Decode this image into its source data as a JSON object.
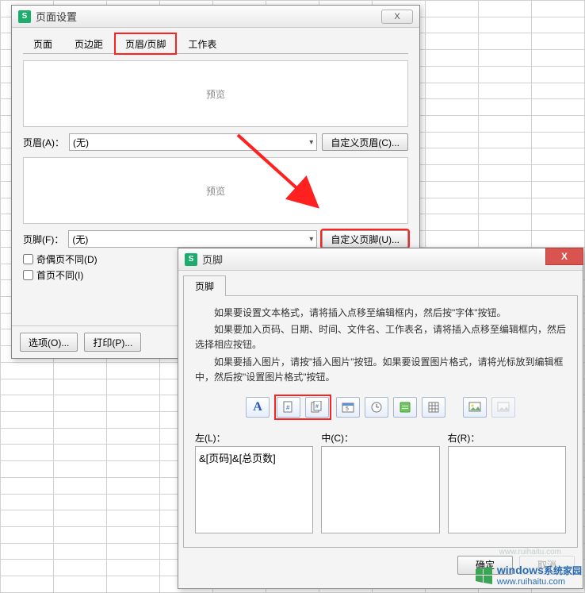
{
  "page_setup": {
    "title": "页面设置",
    "close_glyph": "X",
    "tabs": {
      "page": "页面",
      "margins": "页边距",
      "header_footer": "页眉/页脚",
      "sheet": "工作表"
    },
    "preview_label": "预览",
    "header_label": "页眉(A)：",
    "header_value": "(无)",
    "custom_header_btn": "自定义页眉(C)...",
    "footer_label": "页脚(F)：",
    "footer_value": "(无)",
    "custom_footer_btn": "自定义页脚(U)...",
    "odd_even_diff": "奇偶页不同(D)",
    "first_page_diff": "首页不同(I)",
    "options_btn": "选项(O)...",
    "print_btn": "打印(P)..."
  },
  "footer_dialog": {
    "title": "页脚",
    "close_glyph": "X",
    "tab_label": "页脚",
    "help": {
      "p1": "如果要设置文本格式，请将插入点移至编辑框内，然后按\"字体\"按钮。",
      "p2": "如果要加入页码、日期、时间、文件名、工作表名，请将插入点移至编辑框内，然后选择相应按钮。",
      "p3": "如果要插入图片，请按\"插入图片\"按钮。如果要设置图片格式，请将光标放到编辑框中，然后按\"设置图片格式\"按钮。"
    },
    "tool_font_glyph": "A",
    "left_label": "左(L)：",
    "center_label": "中(C)：",
    "right_label": "右(R)：",
    "left_value": "&[页码]&[总页数]",
    "center_value": "",
    "right_value": "",
    "ok_btn": "确定",
    "cancel_btn": "取消"
  },
  "watermark": {
    "url": "www.ruihaitu.com",
    "brand1": "windows",
    "brand2": "系统家园"
  }
}
